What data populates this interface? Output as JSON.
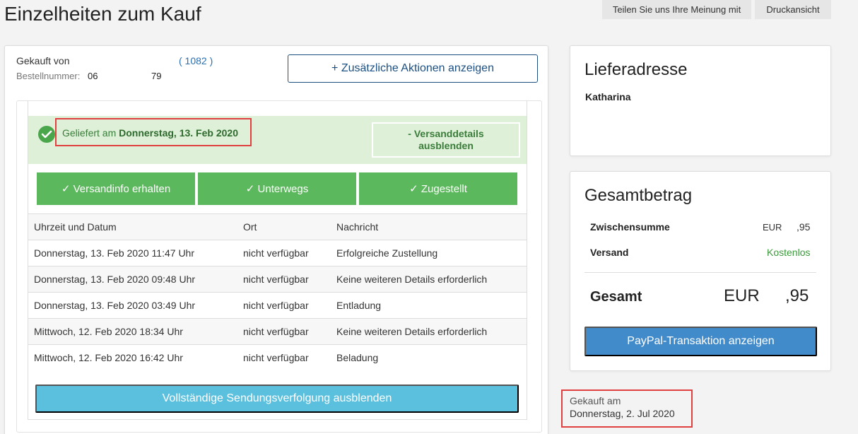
{
  "page": {
    "title": "Einzelheiten zum Kauf",
    "feedback_label": "Teilen Sie uns Ihre Meinung mit",
    "print_label": "Druckansicht"
  },
  "order": {
    "bought_from_label": "Gekauft von",
    "seller_feedback": "( 1082 )",
    "order_number_label": "Bestellnummer:",
    "order_number_part1": "06",
    "order_number_part2": "79",
    "more_actions_label": "+ Zusätzliche Aktionen anzeigen"
  },
  "shipment": {
    "delivered_prefix": "Geliefert am ",
    "delivered_date": "Donnerstag, 13. Feb 2020",
    "hide_details_label": "- Versanddetails ausblenden",
    "steps": [
      "✓ Versandinfo erhalten",
      "✓ Unterwegs",
      "✓ Zugestellt"
    ],
    "table": {
      "headers": [
        "Uhrzeit und Datum",
        "Ort",
        "Nachricht"
      ],
      "rows": [
        [
          "Donnerstag, 13. Feb 2020 11:47 Uhr",
          "nicht verfügbar",
          "Erfolgreiche Zustellung"
        ],
        [
          "Donnerstag, 13. Feb 2020 09:48 Uhr",
          "nicht verfügbar",
          "Keine weiteren Details erforderlich"
        ],
        [
          "Donnerstag, 13. Feb 2020 03:49 Uhr",
          "nicht verfügbar",
          "Entladung"
        ],
        [
          "Mittwoch, 12. Feb 2020 18:34 Uhr",
          "nicht verfügbar",
          "Keine weiteren Details erforderlich"
        ],
        [
          "Mittwoch, 12. Feb 2020 16:42 Uhr",
          "nicht verfügbar",
          "Beladung"
        ]
      ]
    },
    "hide_tracking_label": "Vollständige Sendungsverfolgung ausblenden"
  },
  "address": {
    "title": "Lieferadresse",
    "recipient": "Katharina"
  },
  "totals": {
    "title": "Gesamtbetrag",
    "subtotal_label": "Zwischensumme",
    "subtotal_currency": "EUR",
    "subtotal_amount": ",95",
    "shipping_label": "Versand",
    "shipping_value": "Kostenlos",
    "total_label": "Gesamt",
    "total_currency": "EUR",
    "total_amount": ",95",
    "paypal_label": "PayPal-Transaktion anzeigen"
  },
  "purchase": {
    "label": "Gekauft am",
    "date": "Donnerstag, 2. Jul 2020"
  },
  "colors": {
    "accent_green": "#5cb85c",
    "accent_blue": "#428bca",
    "info_blue": "#5bc0de",
    "highlight_red": "#e04040"
  }
}
